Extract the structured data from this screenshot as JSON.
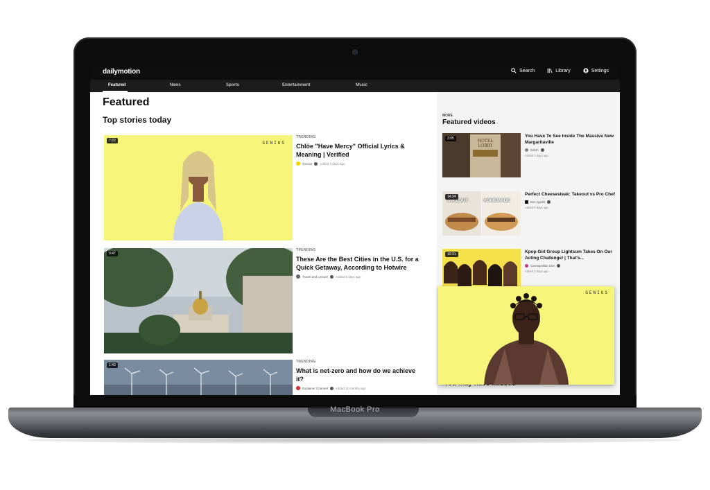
{
  "device": {
    "label": "MacBook Pro"
  },
  "app": {
    "logo": "dailymotion"
  },
  "topnav": [
    {
      "label": "Search",
      "icon": "search-icon"
    },
    {
      "label": "Library",
      "icon": "library-icon"
    },
    {
      "label": "Settings",
      "icon": "user-icon"
    }
  ],
  "categories": [
    "Featured",
    "News",
    "Sports",
    "Entertainment",
    "Music"
  ],
  "active_category": "Featured",
  "page": {
    "title": "Featured",
    "section": "Top stories today"
  },
  "stories": [
    {
      "duration": "7:22",
      "tag": "TRENDING",
      "title": "Chlöe \"Have Mercy\" Official Lyrics & Meaning | Verified",
      "channel": "Genius",
      "added": "Added 3 days ago",
      "watermark": "GENIUS"
    },
    {
      "duration": "0:47",
      "tag": "TRENDING",
      "title": "These Are the Best Cities in the U.S. for a Quick Getaway, According to Hotwire",
      "channel": "Travel and Leisure",
      "added": "Added 5 days ago"
    },
    {
      "duration": "1:43",
      "tag": "TRENDING",
      "title": "What is net-zero and how do we achieve it?",
      "channel": "Explainer Channel",
      "added": "Added 11 months ago"
    }
  ],
  "featured": {
    "more": "MORE",
    "title": "Featured videos",
    "items": [
      {
        "duration": "2:05",
        "title": "You Have To See Inside The Massive New Margaritaville",
        "channel": "Delish",
        "added": "Added 3 days ago",
        "thumb_text": "HOTEL LOBBY"
      },
      {
        "duration": "14:24",
        "title": "Perfect Cheesesteak: Takeout vs Pro Chef",
        "channel": "Bon Appétit",
        "added": "Added 8 days ago",
        "thumb_left": "TAKEOUT",
        "thumb_right": "HOMEMADE"
      },
      {
        "duration": "10:31",
        "title": "Kpop Girl Group Lightsum Takes On Our Acting Challenge! | That's...",
        "channel": "Cosmopolitan USA",
        "added": "Added 3 days ago"
      }
    ]
  },
  "mini_player": {
    "watermark": "GENIUS"
  },
  "under_text": "You may have missed",
  "colors": {
    "genius_yellow": "#f6f57a",
    "topbar": "#0e0e0e"
  }
}
